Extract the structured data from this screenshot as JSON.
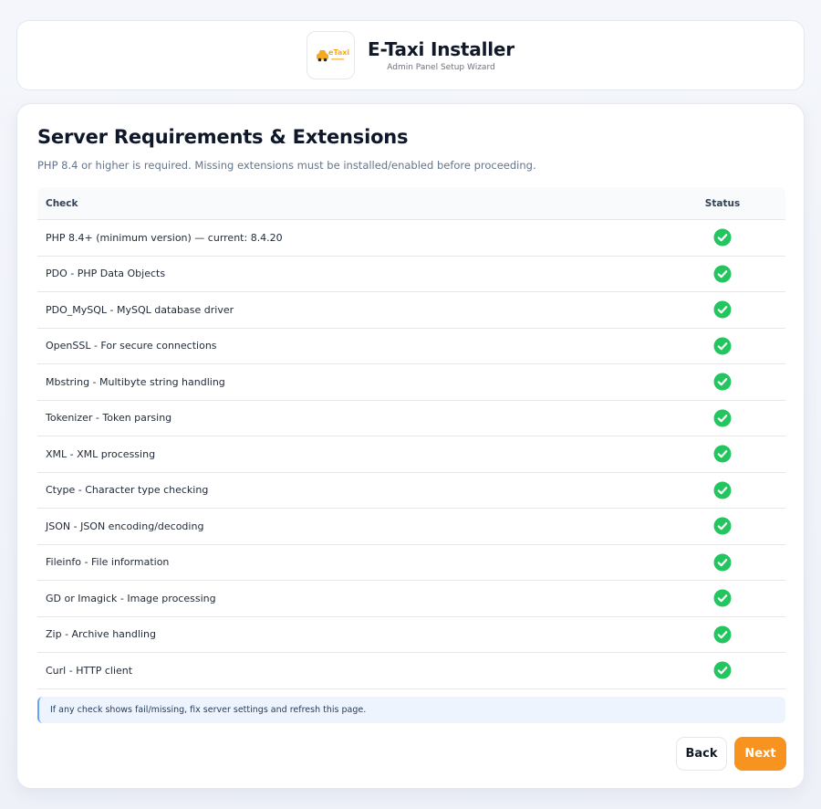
{
  "header": {
    "logo_text": "eTaxi",
    "title": "E-Taxi Installer",
    "subtitle": "Admin Panel Setup Wizard"
  },
  "section": {
    "title": "Server Requirements & Extensions",
    "description": "PHP 8.4 or higher is required. Missing extensions must be installed/enabled before proceeding."
  },
  "table": {
    "headers": {
      "check": "Check",
      "status": "Status"
    },
    "rows": [
      {
        "check": "PHP 8.4+ (minimum version) — current: 8.4.20",
        "status": "pass"
      },
      {
        "check": "PDO - PHP Data Objects",
        "status": "pass"
      },
      {
        "check": "PDO_MySQL - MySQL database driver",
        "status": "pass"
      },
      {
        "check": "OpenSSL - For secure connections",
        "status": "pass"
      },
      {
        "check": "Mbstring - Multibyte string handling",
        "status": "pass"
      },
      {
        "check": "Tokenizer - Token parsing",
        "status": "pass"
      },
      {
        "check": "XML - XML processing",
        "status": "pass"
      },
      {
        "check": "Ctype - Character type checking",
        "status": "pass"
      },
      {
        "check": "JSON - JSON encoding/decoding",
        "status": "pass"
      },
      {
        "check": "Fileinfo - File information",
        "status": "pass"
      },
      {
        "check": "GD or Imagick - Image processing",
        "status": "pass"
      },
      {
        "check": "Zip - Archive handling",
        "status": "pass"
      },
      {
        "check": "Curl - HTTP client",
        "status": "pass"
      }
    ]
  },
  "note": "If any check shows fail/missing, fix server settings and refresh this page.",
  "buttons": {
    "back": "Back",
    "next": "Next"
  },
  "colors": {
    "accent": "#f7931e",
    "success": "#22c55e",
    "info_border": "#60a5fa"
  },
  "icons": {
    "status_pass": "check-circle-icon",
    "logo": "taxi-logo-icon"
  }
}
